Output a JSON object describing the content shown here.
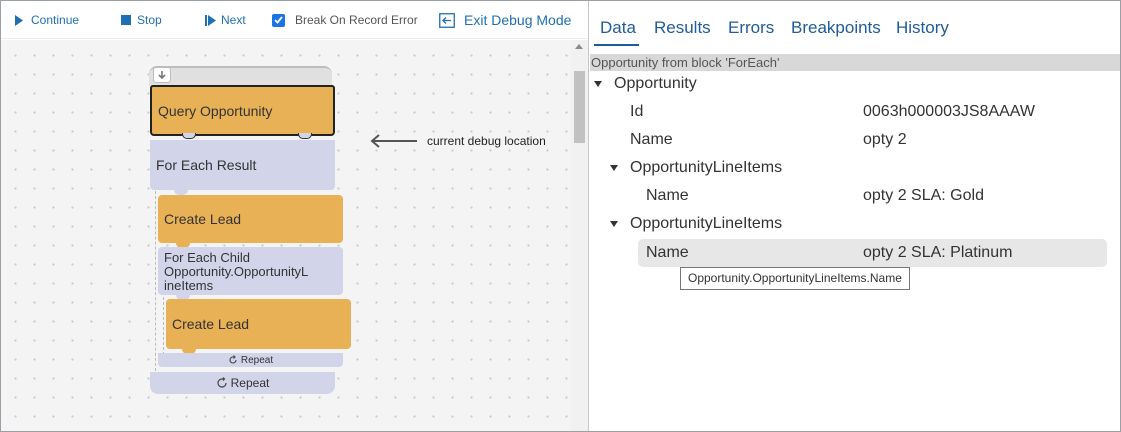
{
  "toolbar": {
    "continue_label": "Continue",
    "stop_label": "Stop",
    "next_label": "Next",
    "break_label": "Break On Record Error",
    "break_checked": true,
    "exit_label": "Exit Debug Mode"
  },
  "canvas": {
    "blocks": {
      "query": "Query Opportunity",
      "foreach": "For Each Result",
      "lead1": "Create Lead",
      "child_line1": "For Each Child",
      "child_line2": "Opportunity.OpportunityL",
      "child_line3": "ineItems",
      "lead2": "Create Lead",
      "repeat_inner": "Repeat",
      "repeat_outer": "Repeat"
    },
    "debug_label": "current debug location"
  },
  "tabs": [
    "Data",
    "Results",
    "Errors",
    "Breakpoints",
    "History"
  ],
  "active_tab": "Data",
  "data_panel": {
    "context": "Opportunity from block 'ForEach'",
    "root": "Opportunity",
    "id_key": "Id",
    "id_val": "0063h000003JS8AAAW",
    "name_key": "Name",
    "name_val": "opty 2",
    "group1": "OpportunityLineItems",
    "group1_name_key": "Name",
    "group1_name_val": "opty 2 SLA: Gold",
    "group2": "OpportunityLineItems",
    "group2_name_key": "Name",
    "group2_name_val": "opty 2 SLA: Platinum",
    "tooltip": "Opportunity.OpportunityLineItems.Name"
  },
  "colors": {
    "accent": "#1f5c99",
    "block_orange": "#e8b155",
    "block_purple": "#d2d4ea"
  }
}
